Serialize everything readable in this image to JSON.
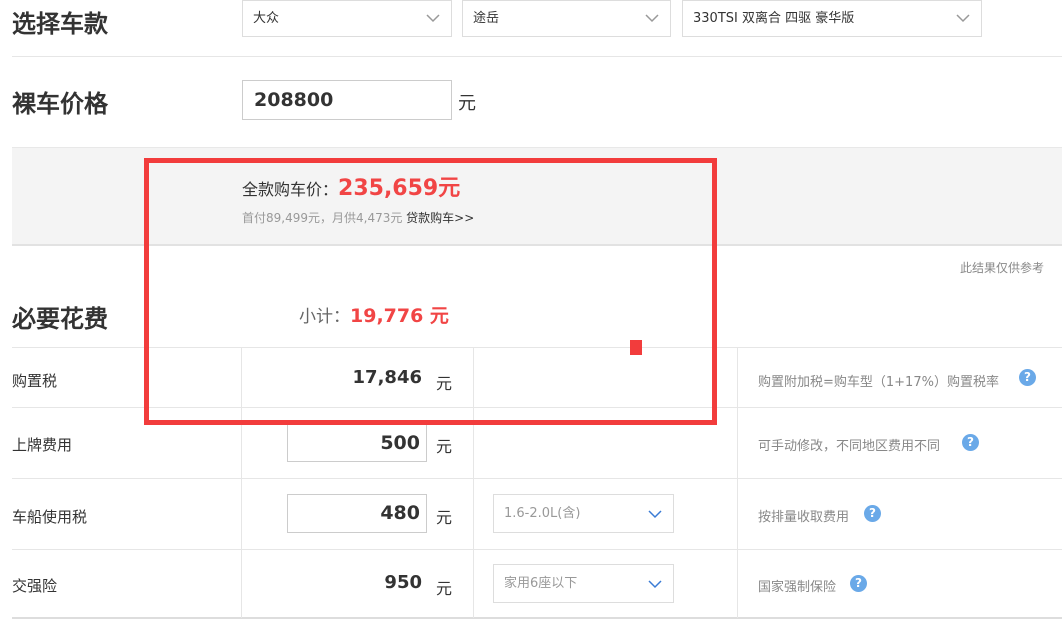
{
  "car_select": {
    "title": "选择车款",
    "brand": "大众",
    "model": "途岳",
    "version": "330TSI 双离合 四驱 豪华版"
  },
  "bare_price": {
    "title": "裸车价格",
    "value": "208800",
    "unit": "元"
  },
  "summary": {
    "full_label": "全款购车价：",
    "full_value": "235,659元",
    "loan_text": "首付89,499元，月供4,473元",
    "loan_link": "贷款购车>>",
    "disclaimer": "此结果仅供参考"
  },
  "required": {
    "title": "必要花费",
    "subtotal_label": "小计：",
    "subtotal_value": "19,776 元",
    "rows": [
      {
        "label": "购置税",
        "value": "17,846",
        "unit": "元",
        "note": "购置附加税=购车型（1+17%）购置税率"
      },
      {
        "label": "上牌费用",
        "value": "500",
        "unit": "元",
        "note": "可手动修改，不同地区费用不同"
      },
      {
        "label": "车船使用税",
        "value": "480",
        "unit": "元",
        "select": "1.6-2.0L(含)",
        "note": "按排量收取费用"
      },
      {
        "label": "交强险",
        "value": "950",
        "unit": "元",
        "select": "家用6座以下",
        "note": "国家强制保险"
      }
    ]
  },
  "icons": {
    "help": "question-circle-icon",
    "dropdown": "chevron-down-icon"
  },
  "colors": {
    "accent_red": "#f14545",
    "help_blue": "#6aa9e8",
    "annotation_red": "#f23c3c"
  }
}
